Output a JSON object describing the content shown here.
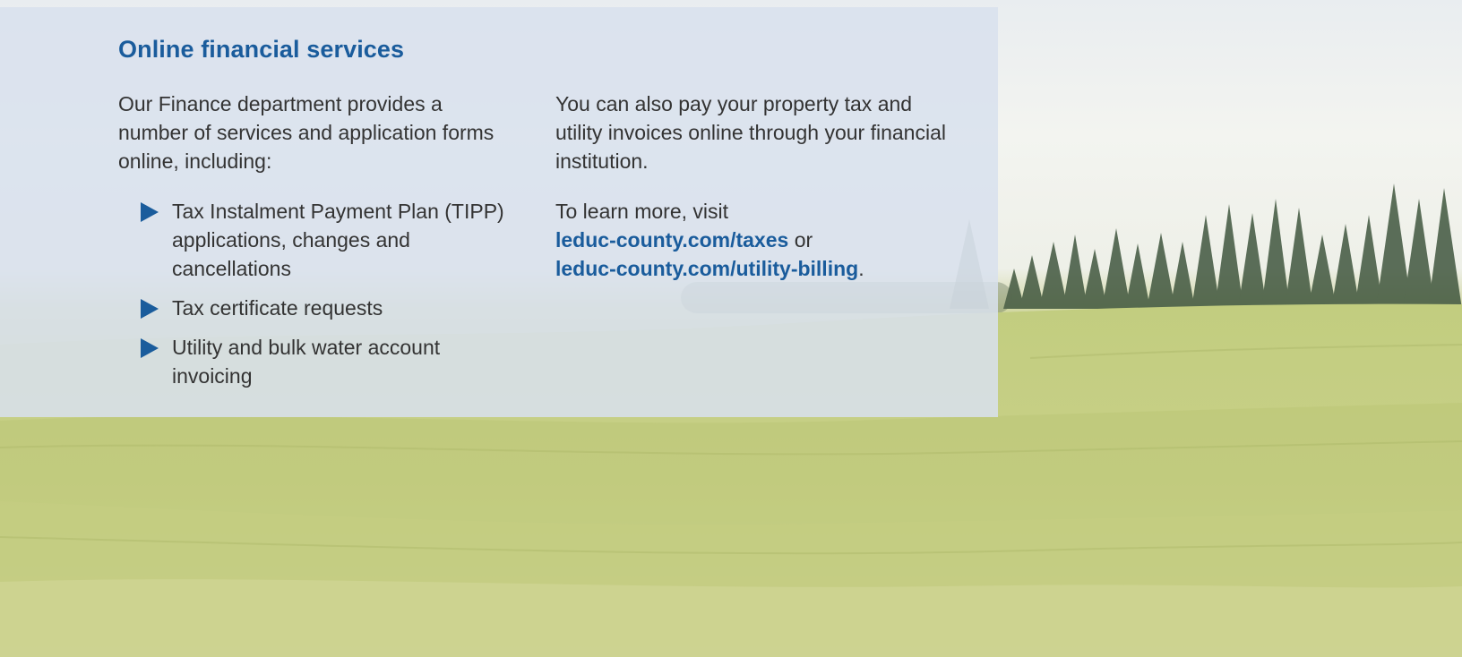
{
  "heading": "Online financial services",
  "left_column": {
    "intro": "Our Finance department provides a number of services and application forms online, including:",
    "items": [
      "Tax Instalment Payment Plan (TIPP) applications, changes and cancellations",
      "Tax certificate requests",
      "Utility and bulk water account invoicing"
    ]
  },
  "right_column": {
    "intro": "You can also pay your property tax and utility invoices online through your financial institution.",
    "learn_prefix": "To learn more, visit",
    "link1": "leduc-county.com/taxes",
    "connector": "or",
    "link2": "leduc-county.com/utility-billing",
    "end_period": "."
  },
  "colors": {
    "heading": "#1a5c9c",
    "link": "#1a5c9c",
    "body_text": "#333333",
    "panel": "#d8e1ee"
  },
  "icons": {
    "bullet": "triangle-bullet-icon",
    "background": "wheat-field-photo"
  }
}
